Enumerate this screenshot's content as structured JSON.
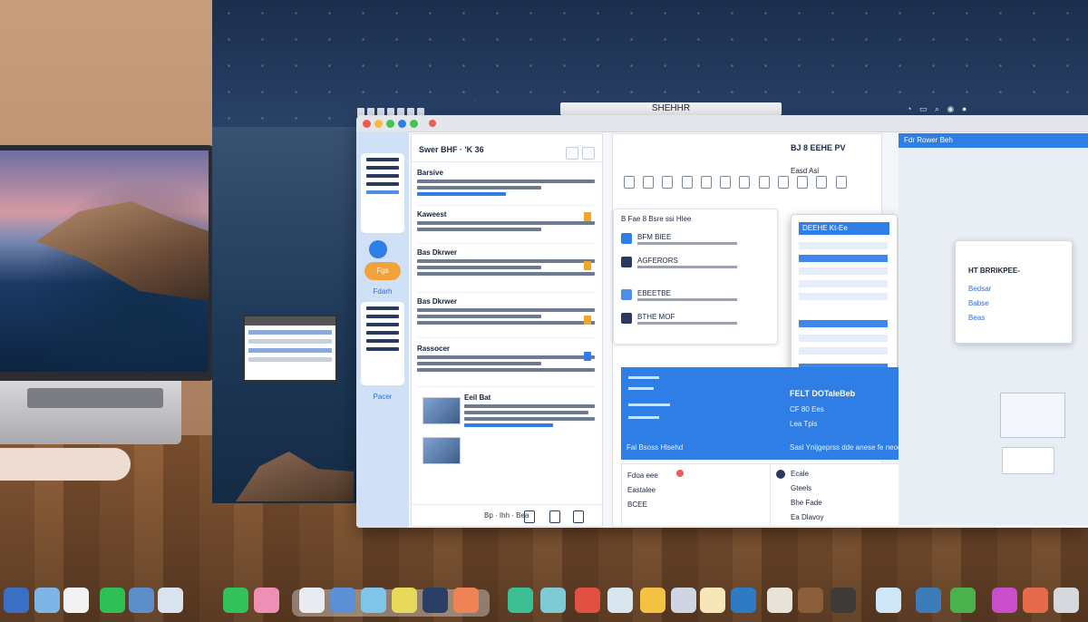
{
  "menubar": {
    "title": "SHEHHR"
  },
  "window": {
    "list": {
      "title": "Swer BHF · 'K 36",
      "messages": [
        {
          "title": "Barsive"
        },
        {
          "title": "Kaweest"
        },
        {
          "title": "Bas Dkrwer"
        },
        {
          "title": "Bas Dkrwer"
        },
        {
          "title": "Rassocer"
        },
        {
          "title": "Eeil Bat"
        }
      ],
      "footer": "Bp · Ihh · Bea"
    },
    "sidebar": {
      "badge": "Fgs",
      "label_bottom": "Pacer",
      "label_mid": "Fdarh"
    },
    "middle": {
      "title": "BJ 8 EEHE PV",
      "subtitle": "Easd Asi",
      "doc_header": "B Fae 8 Bsre ssi Hlee",
      "docs": [
        {
          "name": "BFM BIEE"
        },
        {
          "name": "AGFERORS"
        },
        {
          "name": "EBEETBE"
        },
        {
          "name": "BTHE MOF"
        }
      ],
      "popup_header": "DEEHE Kt-Ee"
    },
    "banner": {
      "title": "FELT DOTaleBeb",
      "sub1": "CF 80 Ees",
      "sub2": "Lea Tpis",
      "foot": "Fal Bsoss Hlsehd",
      "foot2": "Sasl Ynijgeprss dde anese fe neoc"
    },
    "bottom_left": [
      "Fdoa eee",
      "Eastalee",
      "BCEE"
    ],
    "bottom_right": [
      "Ecale",
      "Gteels",
      "Bhe Fade",
      "Ea Dlavoy"
    ],
    "right": {
      "header": "Fdr Rower Beh",
      "card_title": "HT BRRIKPEE-",
      "card_rows": [
        "Bedsar",
        "Babse",
        "Beas"
      ]
    }
  },
  "colors": {
    "accent": "#2f7ee6",
    "flag": "#f1a629"
  }
}
